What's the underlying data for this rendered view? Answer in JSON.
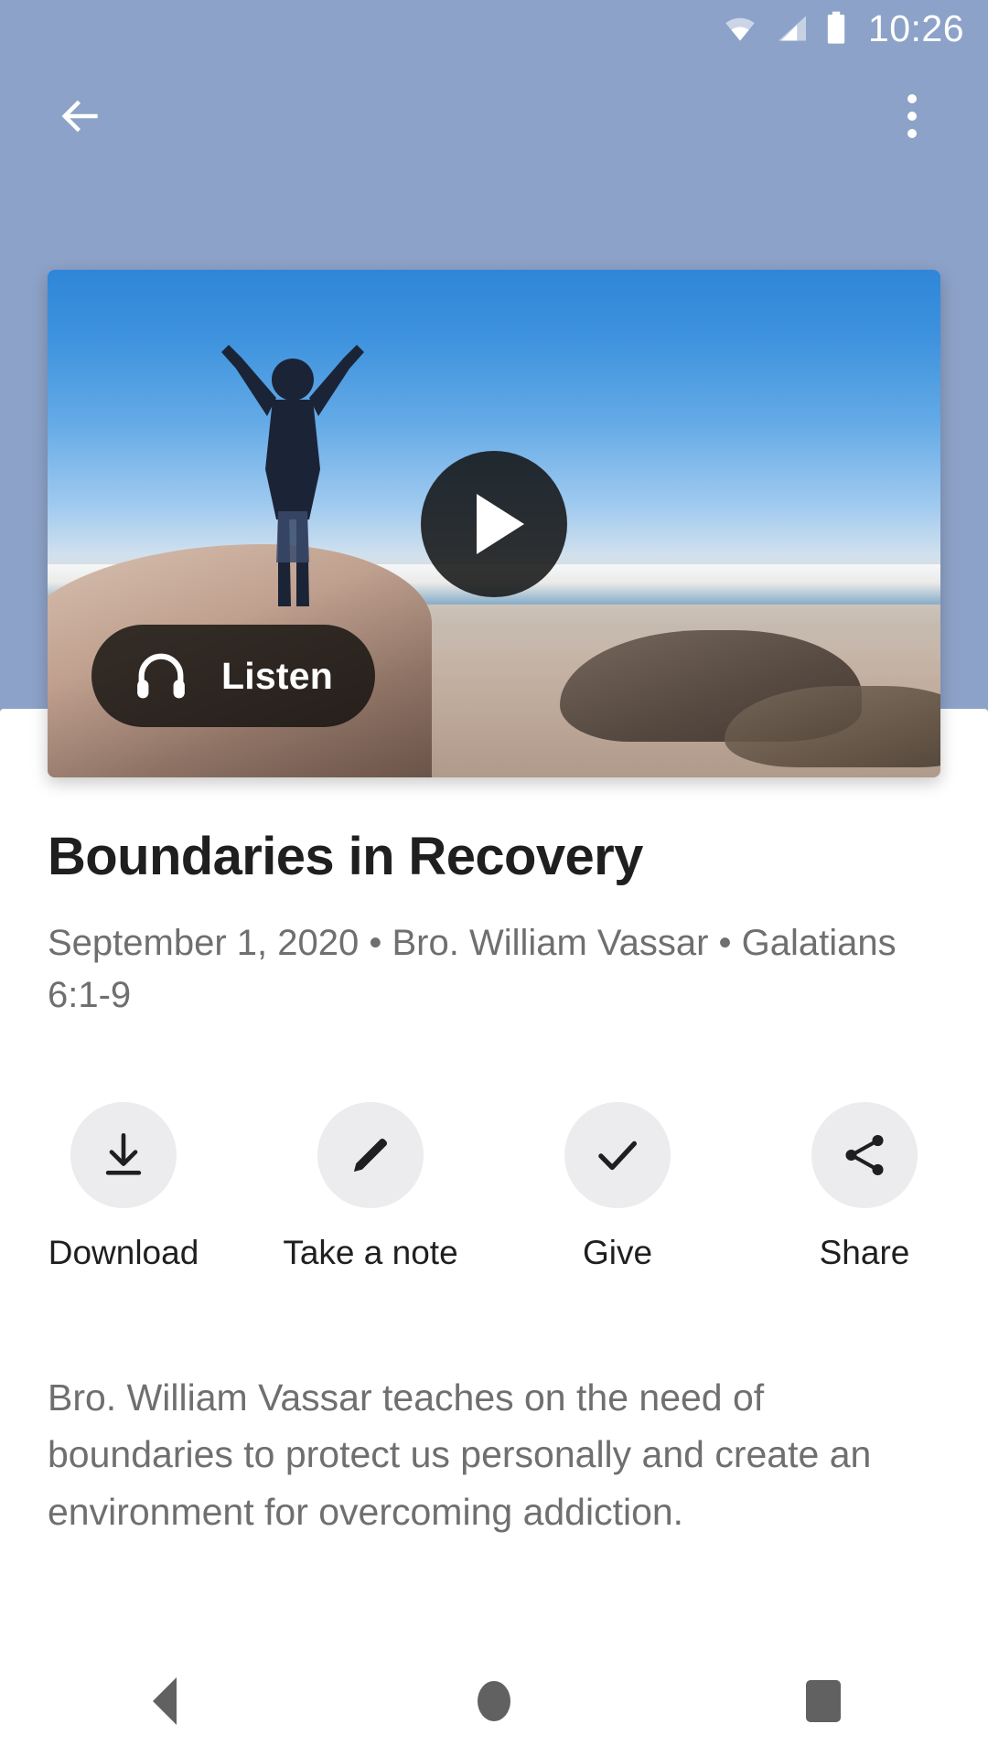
{
  "status_bar": {
    "time": "10:26",
    "icons": [
      "wifi-icon",
      "cellular-signal-icon",
      "battery-icon"
    ]
  },
  "app_bar": {
    "back_icon": "back-arrow-icon",
    "overflow_icon": "more-vertical-icon"
  },
  "media": {
    "play_icon": "play-icon",
    "listen_label": "Listen",
    "listen_icon": "headphones-icon",
    "thumbnail_alt": "person standing on beach rock with arms raised at sunset"
  },
  "sermon": {
    "title": "Boundaries in Recovery",
    "meta": "September 1, 2020 • Bro. William Vassar • Galatians 6:1-9",
    "date": "September 1, 2020",
    "speaker": "Bro. William Vassar",
    "scripture": "Galatians 6:1-9",
    "description": "Bro. William Vassar teaches on the need of boundaries to protect us personally and create an environment for overcoming addiction."
  },
  "actions": [
    {
      "label": "Download",
      "icon": "download-icon"
    },
    {
      "label": "Take a note",
      "icon": "pencil-icon"
    },
    {
      "label": "Give",
      "icon": "check-icon"
    },
    {
      "label": "Share",
      "icon": "share-icon"
    }
  ],
  "nav_bar": {
    "back": "nav-back-icon",
    "home": "nav-home-icon",
    "recents": "nav-recents-icon"
  },
  "colors": {
    "header_background": "#8da2c8",
    "sheet_background": "#ffffff",
    "title_text": "#1f1f1f",
    "muted_text": "#6f6f6f",
    "action_circle": "#ececee",
    "pill_background": "rgba(18,16,14,0.82)"
  }
}
